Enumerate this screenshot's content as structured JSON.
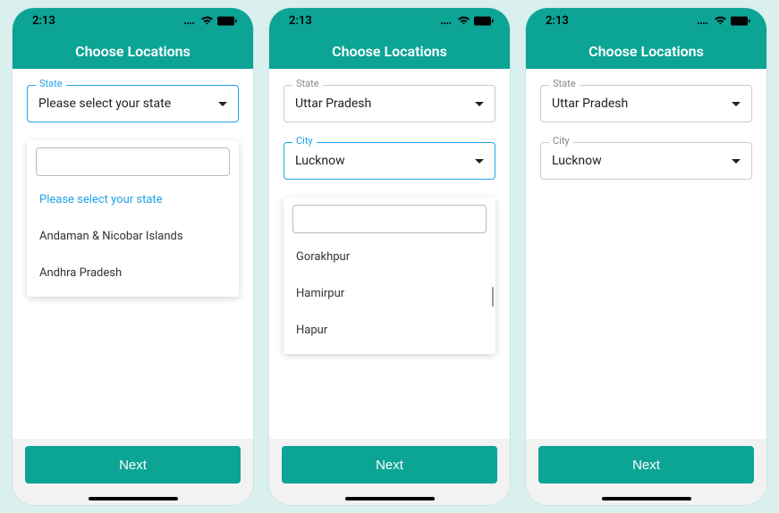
{
  "status": {
    "time": "2:13"
  },
  "header": {
    "title": "Choose Locations"
  },
  "footer": {
    "next": "Next"
  },
  "labels": {
    "state": "State",
    "city": "City"
  },
  "screen1": {
    "state_value": "Please select your state",
    "dropdown": {
      "selected": "Please select your state",
      "options": [
        "Andaman & Nicobar Islands",
        "Andhra Pradesh"
      ]
    }
  },
  "screen2": {
    "state_value": "Uttar Pradesh",
    "city_value": "Lucknow",
    "dropdown": {
      "options": [
        "Gorakhpur",
        "Hamirpur",
        "Hapur"
      ]
    }
  },
  "screen3": {
    "state_value": "Uttar Pradesh",
    "city_value": "Lucknow"
  }
}
